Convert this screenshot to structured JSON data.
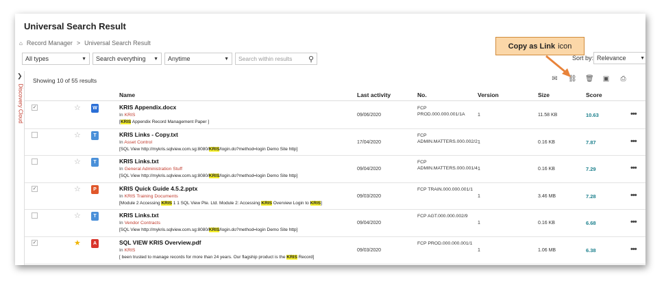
{
  "page": {
    "title": "Universal Search Result",
    "breadcrumb": [
      "Record Manager",
      "Universal Search Result"
    ],
    "breadcrumb_sep": ">"
  },
  "filters": {
    "types": "All types",
    "scope": "Search everything",
    "time": "Anytime",
    "search_placeholder": "Search within results"
  },
  "sort": {
    "label": "Sort by:",
    "value": "Relevance"
  },
  "sidebar": {
    "label": "Discovery Cloud"
  },
  "results": {
    "showing": "Showing 10 of 55 results",
    "columns": {
      "name": "Name",
      "activity": "Last activity",
      "no": "No.",
      "version": "Version",
      "size": "Size",
      "score": "Score"
    },
    "rows": [
      {
        "checked": true,
        "starred": false,
        "file_type": "docx",
        "file_color": "#2b6fd6",
        "file_glyph": "W",
        "name": "KRIS Appendix.docx",
        "in_label": "In",
        "location": "KRIS",
        "snippet": [
          {
            "t": "["
          },
          {
            "t": "KRIS",
            "h": true
          },
          {
            "t": " Appendix Record Management Paper ]"
          }
        ],
        "activity": "09/06/2020",
        "no": "FCP PROD.000.000.001/1A",
        "version": "1",
        "size": "11.58 KB",
        "score": "10.63"
      },
      {
        "checked": false,
        "starred": false,
        "file_type": "txt",
        "file_color": "#4a90d9",
        "file_glyph": "T",
        "name": "KRIS Links - Copy.txt",
        "in_label": "In",
        "location": "Asset Control",
        "snippet": [
          {
            "t": "[SQL View http://mykris.sqlview.com.sg:8080/"
          },
          {
            "t": "KRIS",
            "h": true
          },
          {
            "t": "/login.do?method=login Demo Site http]"
          }
        ],
        "activity": "17/04/2020",
        "no": "FCP ADMIN.MATTERS.000.002/2",
        "version": "1",
        "size": "0.16 KB",
        "score": "7.87"
      },
      {
        "checked": false,
        "starred": false,
        "file_type": "txt",
        "file_color": "#4a90d9",
        "file_glyph": "T",
        "name": "KRIS Links.txt",
        "in_label": "In",
        "location": "General Administration Stuff",
        "snippet": [
          {
            "t": "[SQL View http://mykris.sqlview.com.sg:8080/"
          },
          {
            "t": "KRIS",
            "h": true
          },
          {
            "t": "/login.do?method=login Demo Site http]"
          }
        ],
        "activity": "09/04/2020",
        "no": "FCP ADMIN.MATTERS.000.001/4",
        "version": "1",
        "size": "0.16 KB",
        "score": "7.29"
      },
      {
        "checked": true,
        "starred": false,
        "file_type": "pptx",
        "file_color": "#e0572b",
        "file_glyph": "P",
        "name": "KRIS Quick Guide 4.5.2.pptx",
        "in_label": "In",
        "location": "KRIS Training Documents",
        "snippet": [
          {
            "t": "[Module 2 Accessing "
          },
          {
            "t": "KRIS",
            "h": true
          },
          {
            "t": " 1 1 SQL View Pte. Ltd. Module 2: Accessing "
          },
          {
            "t": "KRIS",
            "h": true
          },
          {
            "t": " Overview Login to "
          },
          {
            "t": "KRIS",
            "h": true
          },
          {
            "t": "]"
          }
        ],
        "activity": "09/03/2020",
        "no": "FCP TRAIN.000.000.001/1",
        "version": "1",
        "size": "3.46 MB",
        "score": "7.28"
      },
      {
        "checked": false,
        "starred": false,
        "file_type": "txt",
        "file_color": "#4a90d9",
        "file_glyph": "T",
        "name": "KRIS Links.txt",
        "in_label": "In",
        "location": "Vendor Contracts",
        "snippet": [
          {
            "t": "[SQL View http://mykris.sqlview.com.sg:8080/"
          },
          {
            "t": "KRIS",
            "h": true
          },
          {
            "t": "/login.do?method=login Demo Site http]"
          }
        ],
        "activity": "09/04/2020",
        "no": "FCP AGT.000.000.002/9",
        "version": "1",
        "size": "0.16 KB",
        "score": "6.68"
      },
      {
        "checked": true,
        "starred": true,
        "file_type": "pdf",
        "file_color": "#d9342b",
        "file_glyph": "A",
        "name": "SQL VIEW KRIS Overview.pdf",
        "in_label": "In",
        "location": "KRIS",
        "snippet": [
          {
            "t": "[ been trusted to manage records for more than 24 years. Our flagship product is the "
          },
          {
            "t": "KRIS",
            "h": true
          },
          {
            "t": " Record]"
          }
        ],
        "activity": "09/03/2020",
        "no": "FCP PROD.000.000.001/1",
        "version": "1",
        "size": "1.06 MB",
        "score": "6.38"
      }
    ]
  },
  "toolbar": {
    "icons": [
      "mail-icon",
      "link-icon",
      "trash-icon",
      "save-icon",
      "print-icon"
    ],
    "glyphs": [
      "✉",
      "⛓",
      "🗑",
      "▣",
      "⎙"
    ]
  },
  "callout": {
    "bold": "Copy as Link",
    "rest": "icon",
    "fill": "#fbd7a8",
    "arrow_color": "#e8833a"
  },
  "accent": {
    "score": "#1a7f8c",
    "location": "#c0392b",
    "highlight": "#f5ef2a"
  }
}
